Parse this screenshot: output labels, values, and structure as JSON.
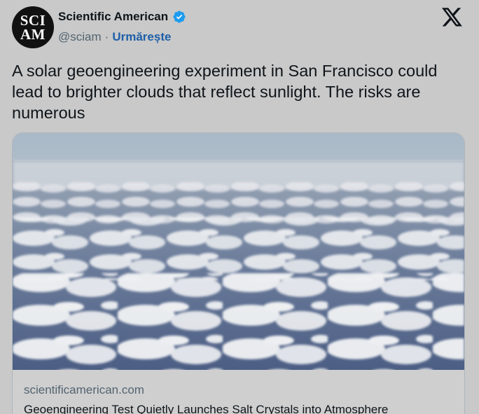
{
  "author": {
    "avatar_text_line1": "SCI",
    "avatar_text_line2": "AM",
    "display_name": "Scientific American",
    "handle": "@sciam",
    "separator": "·",
    "follow_label": "Urmărește",
    "verified_icon": "verified-badge-icon",
    "verified_color": "#1d9bf0"
  },
  "tweet": {
    "text": "A solar geoengineering experiment in San Francisco could lead to brighter clouds that reflect sunlight. The risks are numerous"
  },
  "card": {
    "image": "aerial-clouds-image",
    "domain": "scientificamerican.com",
    "title": "Geoengineering Test Quietly Launches Salt Crystals into Atmosphere"
  },
  "brand": {
    "icon": "x-logo-icon"
  }
}
